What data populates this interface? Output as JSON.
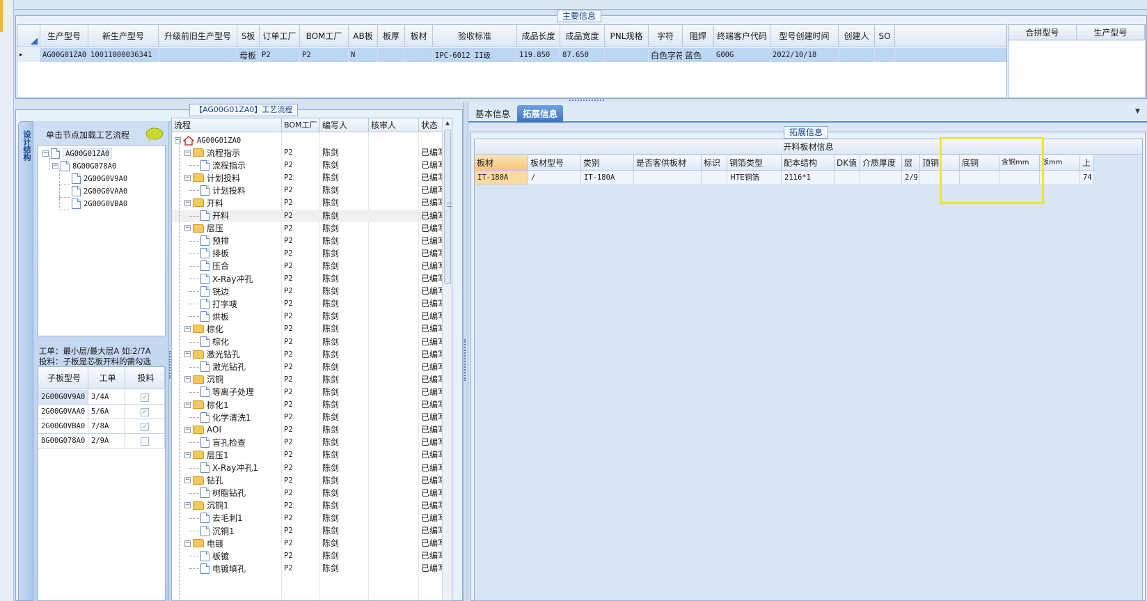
{
  "main_info": {
    "title": "主要信息",
    "columns": [
      "生产型号",
      "新生产型号",
      "升级前旧生产型号",
      "S板",
      "订单工厂",
      "BOM工厂",
      "AB板",
      "板厚",
      "板材",
      "验收标准",
      "成品长度",
      "成品宽度",
      "PNL规格",
      "字符",
      "阻焊",
      "终端客户代码",
      "型号创建时间",
      "创建人",
      "SO"
    ],
    "row": [
      "AG00G01ZA0",
      "10011000036341",
      "",
      "母板",
      "P2",
      "P2",
      "N",
      "",
      "",
      "IPC-6012 II级",
      "119.850",
      "87.650",
      "",
      "白色字符",
      "蓝色",
      "G00G",
      "2022/10/18",
      "",
      ""
    ],
    "right_columns": [
      "合拼型号",
      "生产型号"
    ]
  },
  "process_panel": {
    "title": "【AG00G01ZA0】工艺流程",
    "vertical_tab": "设计结构",
    "hint": "单击节点加载工艺流程",
    "structure_tree": {
      "root": "AG00G01ZA0",
      "child": "8G00G078A0",
      "leaves": [
        "2G00G0V9A0",
        "2G00G0VAA0",
        "2G00G0VBA0"
      ]
    },
    "notes": [
      "工单：最小层/最大层A 如:2/7A",
      "投料：子板是芯板开料的需勾选"
    ],
    "sub_table": {
      "columns": [
        "子板型号",
        "工单",
        "投料"
      ],
      "rows": [
        {
          "model": "2G00G0V9A0",
          "order": "3/4A",
          "checked": true
        },
        {
          "model": "2G00G0VAA0",
          "order": "5/6A",
          "checked": true
        },
        {
          "model": "2G00G0VBA0",
          "order": "7/8A",
          "checked": true
        },
        {
          "model": "8G00G078A0",
          "order": "2/9A",
          "checked": false
        }
      ]
    },
    "flow_columns": [
      "流程",
      "BOM工厂",
      "编写人",
      "核审人",
      "状态"
    ],
    "flow_root": "AG00G01ZA0",
    "flow_items": [
      {
        "level": 1,
        "name": "流程指示",
        "factory": "P2",
        "writer": "陈剑",
        "status": "已编写"
      },
      {
        "level": 2,
        "name": "流程指示",
        "factory": "P2",
        "writer": "陈剑",
        "status": "已编写"
      },
      {
        "level": 1,
        "name": "计划投料",
        "factory": "P2",
        "writer": "陈剑",
        "status": "已编写"
      },
      {
        "level": 2,
        "name": "计划投料",
        "factory": "P2",
        "writer": "陈剑",
        "status": "已编写"
      },
      {
        "level": 1,
        "name": "开料",
        "factory": "P2",
        "writer": "陈剑",
        "status": "已编写"
      },
      {
        "level": 2,
        "name": "开料",
        "factory": "P2",
        "writer": "陈剑",
        "status": "已编写"
      },
      {
        "level": 1,
        "name": "层压",
        "factory": "P2",
        "writer": "陈剑",
        "status": "已编写"
      },
      {
        "level": 2,
        "name": "预排",
        "factory": "P2",
        "writer": "陈剑",
        "status": "已编写"
      },
      {
        "level": 2,
        "name": "排板",
        "factory": "P2",
        "writer": "陈剑",
        "status": "已编写"
      },
      {
        "level": 2,
        "name": "压合",
        "factory": "P2",
        "writer": "陈剑",
        "status": "已编写"
      },
      {
        "level": 2,
        "name": "X-Ray冲孔",
        "factory": "P2",
        "writer": "陈剑",
        "status": "已编写"
      },
      {
        "level": 2,
        "name": "铣边",
        "factory": "P2",
        "writer": "陈剑",
        "status": "已编写"
      },
      {
        "level": 2,
        "name": "打字唛",
        "factory": "P2",
        "writer": "陈剑",
        "status": "已编写"
      },
      {
        "level": 2,
        "name": "烘板",
        "factory": "P2",
        "writer": "陈剑",
        "status": "已编写"
      },
      {
        "level": 1,
        "name": "棕化",
        "factory": "P2",
        "writer": "陈剑",
        "status": "已编写"
      },
      {
        "level": 2,
        "name": "棕化",
        "factory": "P2",
        "writer": "陈剑",
        "status": "已编写"
      },
      {
        "level": 1,
        "name": "激光钻孔",
        "factory": "P2",
        "writer": "陈剑",
        "status": "已编写"
      },
      {
        "level": 2,
        "name": "激光钻孔",
        "factory": "P2",
        "writer": "陈剑",
        "status": "已编写"
      },
      {
        "level": 1,
        "name": "沉铜",
        "factory": "P2",
        "writer": "陈剑",
        "status": "已编写"
      },
      {
        "level": 2,
        "name": "等离子处理",
        "factory": "P2",
        "writer": "陈剑",
        "status": "已编写"
      },
      {
        "level": 1,
        "name": "棕化1",
        "factory": "P2",
        "writer": "陈剑",
        "status": "已编写"
      },
      {
        "level": 2,
        "name": "化学清洗1",
        "factory": "P2",
        "writer": "陈剑",
        "status": "已编写"
      },
      {
        "level": 1,
        "name": "AOI",
        "factory": "P2",
        "writer": "陈剑",
        "status": "已编写"
      },
      {
        "level": 2,
        "name": "盲孔检查",
        "factory": "P2",
        "writer": "陈剑",
        "status": "已编写"
      },
      {
        "level": 1,
        "name": "层压1",
        "factory": "P2",
        "writer": "陈剑",
        "status": "已编写"
      },
      {
        "level": 2,
        "name": "X-Ray冲孔1",
        "factory": "P2",
        "writer": "陈剑",
        "status": "已编写"
      },
      {
        "level": 1,
        "name": "钻孔",
        "factory": "P2",
        "writer": "陈剑",
        "status": "已编写"
      },
      {
        "level": 2,
        "name": "树脂钻孔",
        "factory": "P2",
        "writer": "陈剑",
        "status": "已编写"
      },
      {
        "level": 1,
        "name": "沉铜1",
        "factory": "P2",
        "writer": "陈剑",
        "status": "已编写"
      },
      {
        "level": 2,
        "name": "去毛刺1",
        "factory": "P2",
        "writer": "陈剑",
        "status": "已编写"
      },
      {
        "level": 2,
        "name": "沉铜1",
        "factory": "P2",
        "writer": "陈剑",
        "status": "已编写"
      },
      {
        "level": 1,
        "name": "电镀",
        "factory": "P2",
        "writer": "陈剑",
        "status": "已编写"
      },
      {
        "level": 2,
        "name": "板镀",
        "factory": "P2",
        "writer": "陈剑",
        "status": "已编写"
      },
      {
        "level": 2,
        "name": "电镀填孔",
        "factory": "P2",
        "writer": "陈剑",
        "status": "已编写"
      }
    ]
  },
  "right_panel": {
    "tabs": [
      "基本信息",
      "拓展信息"
    ],
    "active_tab": "拓展信息",
    "group_title": "拓展信息",
    "table_title": "开料板材信息",
    "columns": [
      "板材",
      "板材型号",
      "类别",
      "是否客供板材",
      "标识",
      "铜箔类型",
      "配本结构",
      "DK值",
      "介质厚度",
      "层",
      "顶铜",
      "底铜",
      "含铜mm",
      "板mm",
      "上"
    ],
    "row": [
      "IT-180A",
      "/",
      "IT-180A",
      "",
      "",
      "HTE铜箔",
      "2116*1",
      "",
      "",
      "2/9",
      "",
      "",
      "",
      "",
      "74"
    ],
    "highlight_color": "#f3e33a"
  }
}
